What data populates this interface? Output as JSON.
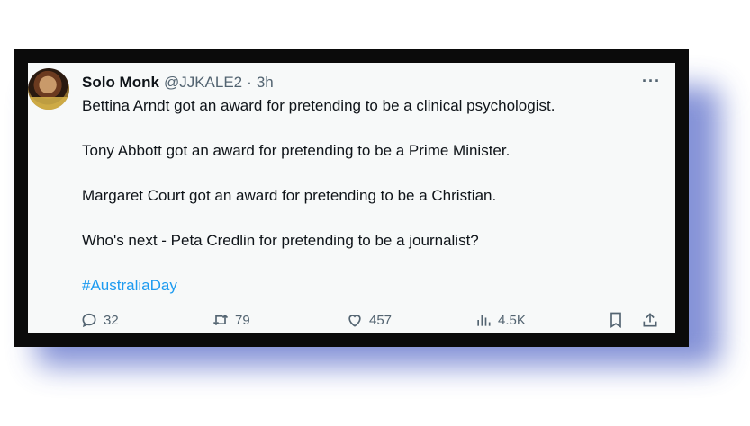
{
  "tweet": {
    "author_name": "Solo Monk",
    "handle": "@JJKALE2",
    "separator": "·",
    "time": "3h",
    "more": "···",
    "paragraphs": [
      "Bettina Arndt got an award for pretending to be a clinical psychologist.",
      "Tony Abbott got an award for pretending to be a Prime Minister.",
      "Margaret Court got an award for pretending to be a Christian.",
      "Who's next - Peta Credlin for pretending to be a journalist?"
    ],
    "hashtag": "#AustraliaDay",
    "stats": {
      "replies": "32",
      "retweets": "79",
      "likes": "457",
      "views": "4.5K"
    }
  },
  "colors": {
    "link": "#1d9bf0",
    "text": "#0f1419",
    "muted": "#536471",
    "frame": "#0b0b0b",
    "glow": "#6f7fd0"
  },
  "icons": [
    "avatar",
    "more-icon",
    "reply-icon",
    "retweet-icon",
    "like-icon",
    "views-icon",
    "bookmark-icon",
    "share-icon"
  ]
}
